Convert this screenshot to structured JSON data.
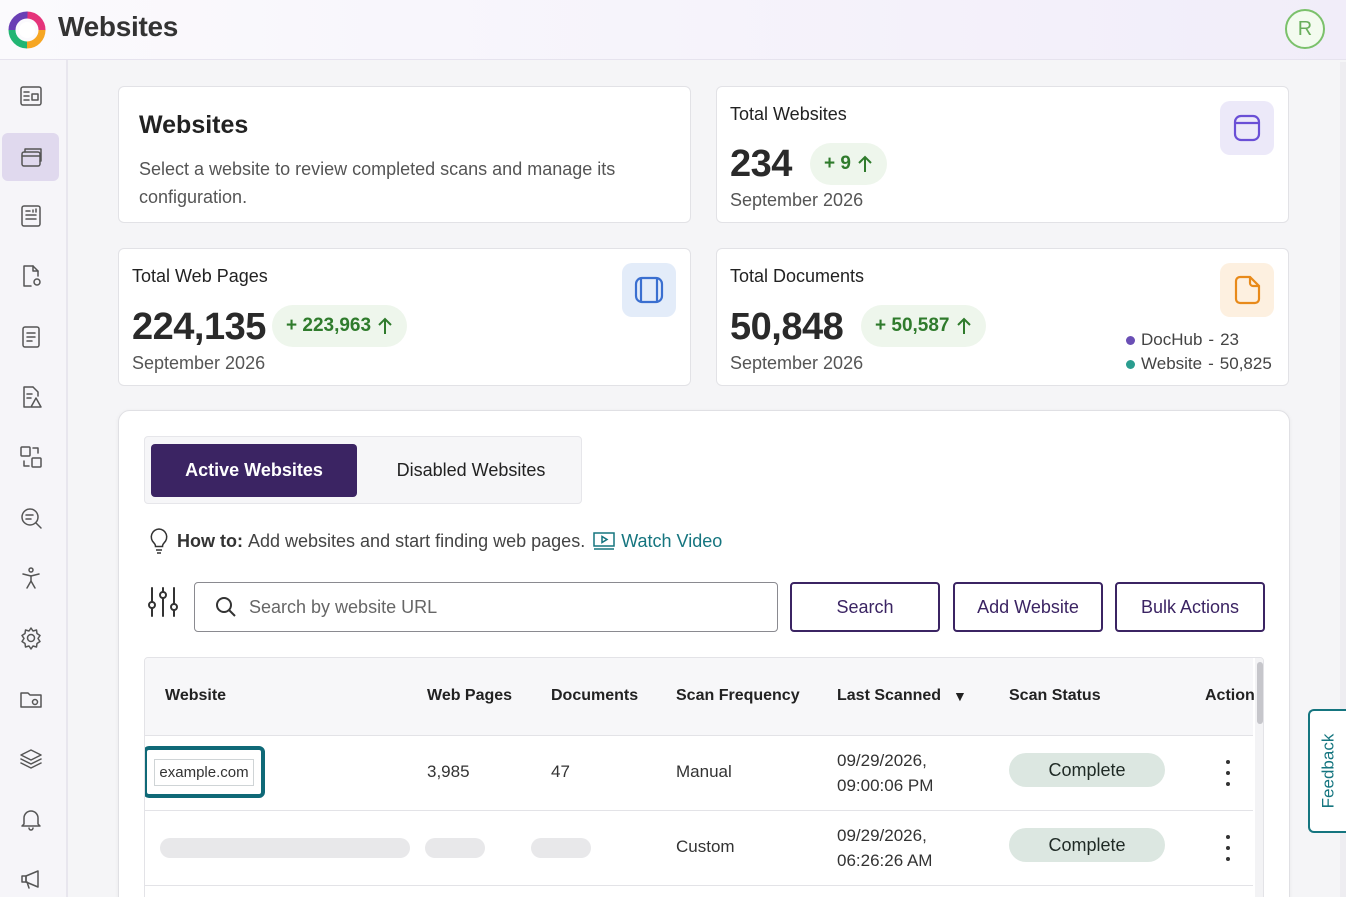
{
  "app": {
    "title": "Websites",
    "avatar_initial": "R"
  },
  "sidebar": {
    "items": [
      {
        "icon": "dashboard-icon",
        "active": false
      },
      {
        "icon": "websites-icon",
        "active": true
      },
      {
        "icon": "reports-icon",
        "active": false
      },
      {
        "icon": "document-settings-icon",
        "active": false
      },
      {
        "icon": "document-list-icon",
        "active": false
      },
      {
        "icon": "document-warning-icon",
        "active": false
      },
      {
        "icon": "convert-icon",
        "active": false
      },
      {
        "icon": "search-scan-icon",
        "active": false
      },
      {
        "icon": "accessibility-icon",
        "active": false
      },
      {
        "icon": "settings-icon",
        "active": false
      },
      {
        "icon": "folder-settings-icon",
        "active": false
      },
      {
        "icon": "layers-icon",
        "active": false
      },
      {
        "icon": "bell-icon",
        "active": false
      },
      {
        "icon": "megaphone-icon",
        "active": false
      }
    ]
  },
  "intro": {
    "title": "Websites",
    "description": "Select a website to review completed scans and manage its configuration."
  },
  "stats": {
    "websites": {
      "title": "Total Websites",
      "value": "234",
      "delta": "+ 9",
      "date": "September 2026"
    },
    "web_pages": {
      "title": "Total Web Pages",
      "value": "224,135",
      "delta": "+ 223,963",
      "date": "September 2026"
    },
    "documents": {
      "title": "Total Documents",
      "value": "50,848",
      "delta": "+ 50,587",
      "date": "September 2026",
      "legend": [
        {
          "label": "DocHub",
          "sep": "-",
          "value": "23",
          "color": "#6a4fb5"
        },
        {
          "label": "Website",
          "sep": "-",
          "value": "50,825",
          "color": "#2a9d8f"
        }
      ]
    }
  },
  "tabs": {
    "active": "Active Websites",
    "inactive": "Disabled Websites"
  },
  "howto": {
    "label": "How to:",
    "text": "Add websites and start finding web pages.",
    "link": "Watch Video"
  },
  "search": {
    "placeholder": "Search by website URL",
    "value": ""
  },
  "buttons": {
    "search": "Search",
    "add": "Add Website",
    "bulk": "Bulk Actions"
  },
  "table": {
    "columns": [
      "Website",
      "Web Pages",
      "Documents",
      "Scan Frequency",
      "Last Scanned",
      "Scan Status",
      "Action"
    ],
    "sort_indicator": "▼",
    "rows": [
      {
        "website": "example.com",
        "web_pages": "3,985",
        "documents": "47",
        "frequency": "Manual",
        "last_scanned_date": "09/29/2026,",
        "last_scanned_time": "09:00:06 PM",
        "status": "Complete"
      },
      {
        "website": "",
        "web_pages": "",
        "documents": "",
        "frequency": "Custom",
        "last_scanned_date": "09/29/2026,",
        "last_scanned_time": "06:26:26 AM",
        "status": "Complete"
      }
    ]
  },
  "feedback": {
    "label": "Feedback"
  },
  "colors": {
    "primary": "#3b2463",
    "teal": "#15757f",
    "delta_green": "#2f7b2c",
    "status_bg": "#dce7e1"
  }
}
